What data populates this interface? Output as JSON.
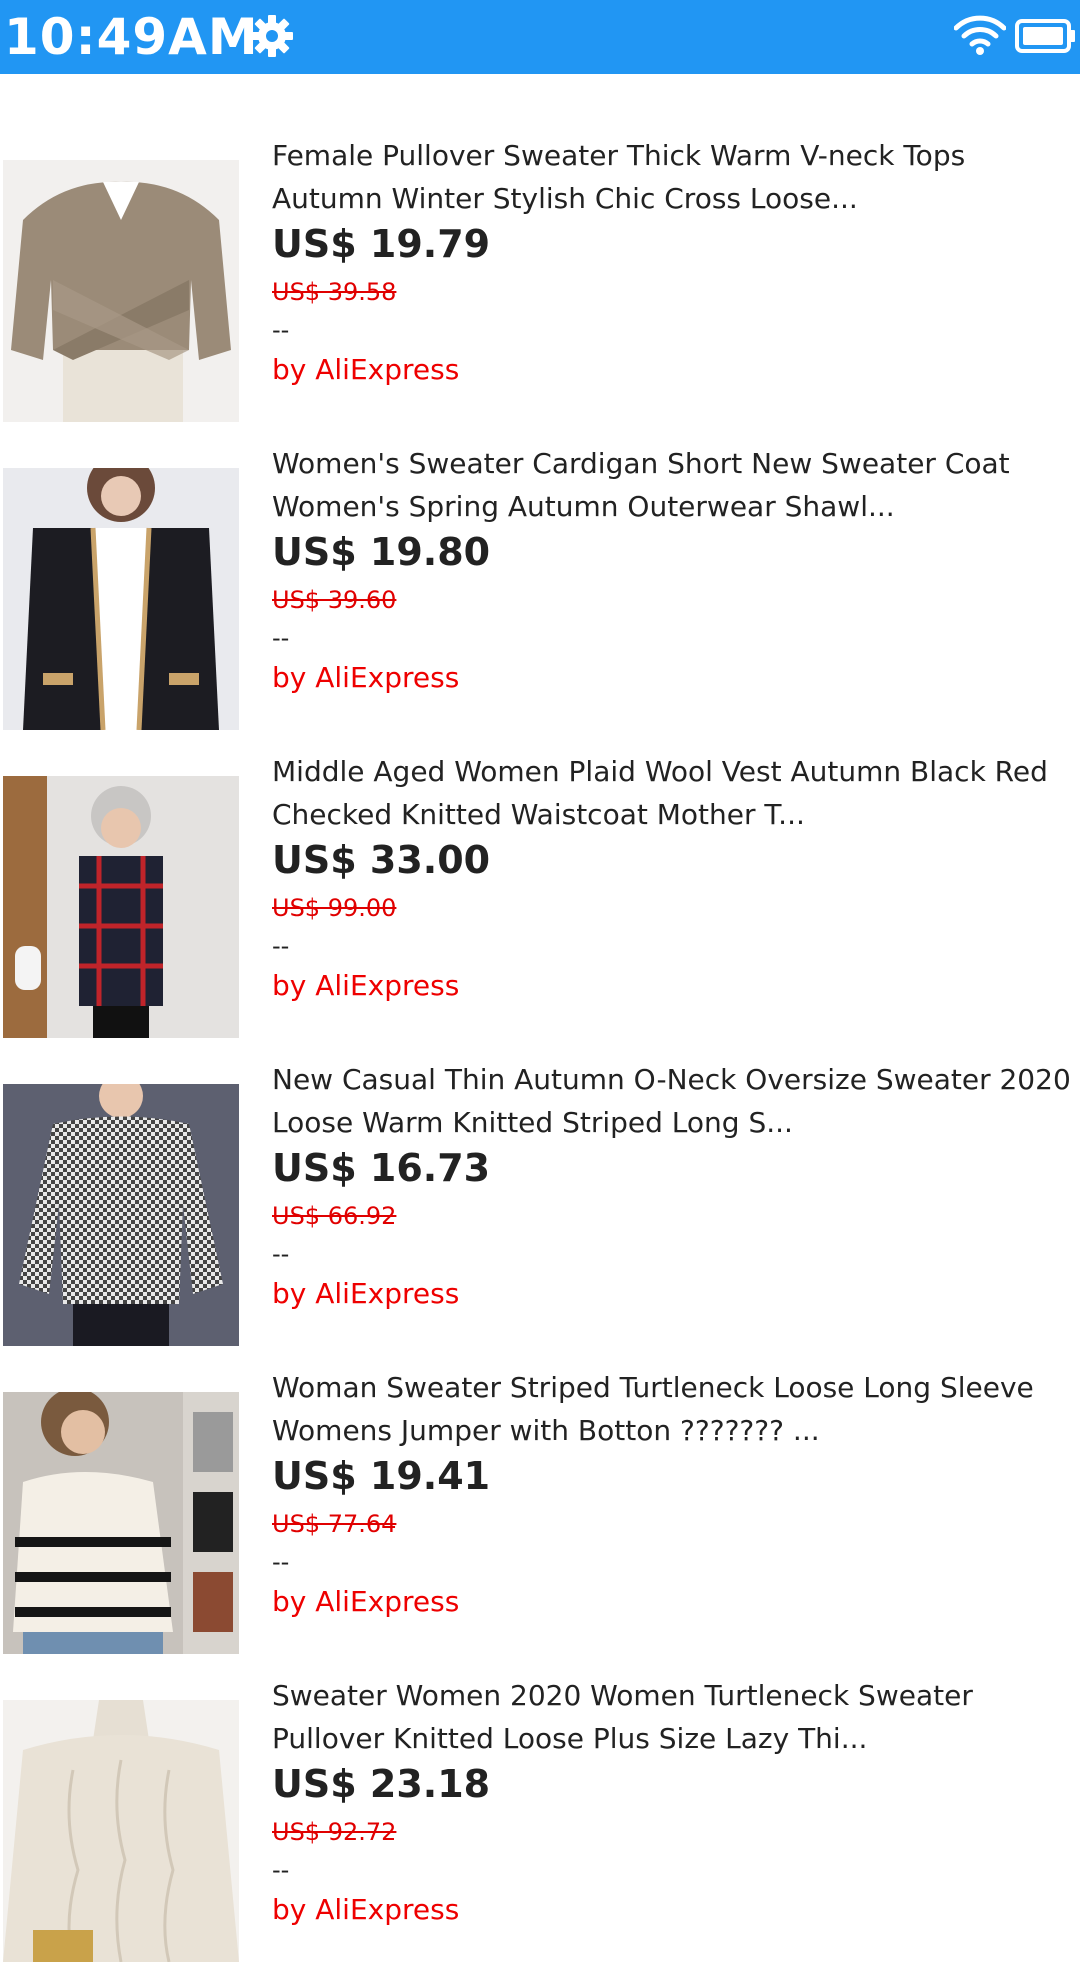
{
  "status_bar": {
    "time": "10:49AM",
    "background_color": "#2196F3",
    "icons": [
      "gear-icon",
      "wifi-icon",
      "battery-icon"
    ]
  },
  "products": [
    {
      "title": "Female Pullover Sweater Thick Warm V-neck Tops Autumn Winter Stylish Chic Cross Loose...",
      "price": "US$ 19.79",
      "original_price": "US$ 39.58",
      "extra": "--",
      "seller": "by AliExpress",
      "image": "taupe-cross-sweater-photo"
    },
    {
      "title": "Women's Sweater Cardigan Short New Sweater Coat Women's Spring Autumn Outerwear Shawl...",
      "price": "US$ 19.80",
      "original_price": "US$ 39.60",
      "extra": "--",
      "seller": "by AliExpress",
      "image": "black-cardigan-photo"
    },
    {
      "title": "Middle Aged Women Plaid Wool Vest Autumn Black Red Checked Knitted Waistcoat Mother T...",
      "price": "US$ 33.00",
      "original_price": "US$ 99.00",
      "extra": "--",
      "seller": "by AliExpress",
      "image": "plaid-vest-photo"
    },
    {
      "title": "New Casual Thin Autumn O-Neck Oversize Sweater 2020 Loose Warm Knitted Striped Long S...",
      "price": "US$ 16.73",
      "original_price": "US$ 66.92",
      "extra": "--",
      "seller": "by AliExpress",
      "image": "checked-oversize-sweater-photo"
    },
    {
      "title": "Woman Sweater Striped Turtleneck Loose Long Sleeve Womens Jumper with Botton ??????? ...",
      "price": "US$ 19.41",
      "original_price": "US$ 77.64",
      "extra": "--",
      "seller": "by AliExpress",
      "image": "striped-turtleneck-photo"
    },
    {
      "title": "Sweater Women 2020 Women Turtleneck Sweater Pullover Knitted Loose Plus Size Lazy Thi...",
      "price": "US$ 23.18",
      "original_price": "US$ 92.72",
      "extra": "--",
      "seller": "by AliExpress",
      "image": "cream-turtleneck-photo"
    }
  ],
  "colors": {
    "price": "#222222",
    "original_price": "#e00000",
    "seller": "#ee0000"
  }
}
